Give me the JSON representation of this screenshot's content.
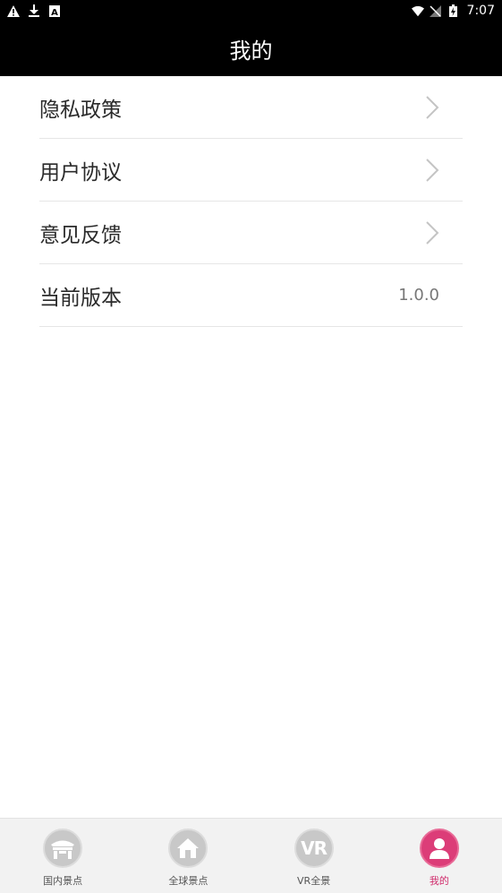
{
  "status_bar": {
    "time": "7:07",
    "left_icons": [
      "warning-icon",
      "download-icon",
      "a-icon"
    ],
    "right_icons": [
      "wifi-icon",
      "no-signal-icon",
      "battery-charging-icon"
    ]
  },
  "header": {
    "title": "我的"
  },
  "menu": {
    "items": [
      {
        "label": "隐私政策",
        "icon": "chevron-right-icon"
      },
      {
        "label": "用户协议",
        "icon": "chevron-right-icon"
      },
      {
        "label": "意见反馈",
        "icon": "chevron-right-icon"
      },
      {
        "label": "当前版本",
        "value": "1.0.0"
      }
    ]
  },
  "tabs": [
    {
      "label": "国内景点",
      "icon": "temple-icon",
      "active": false
    },
    {
      "label": "全球景点",
      "icon": "house-icon",
      "active": false
    },
    {
      "label": "VR全景",
      "icon": "vr-icon",
      "active": false
    },
    {
      "label": "我的",
      "icon": "user-icon",
      "active": true
    }
  ],
  "colors": {
    "header_bg": "#000000",
    "active_tab": "#dc3d78",
    "inactive_tab": "#c8c8c8",
    "tab_bar_bg": "#f2f2f2"
  }
}
